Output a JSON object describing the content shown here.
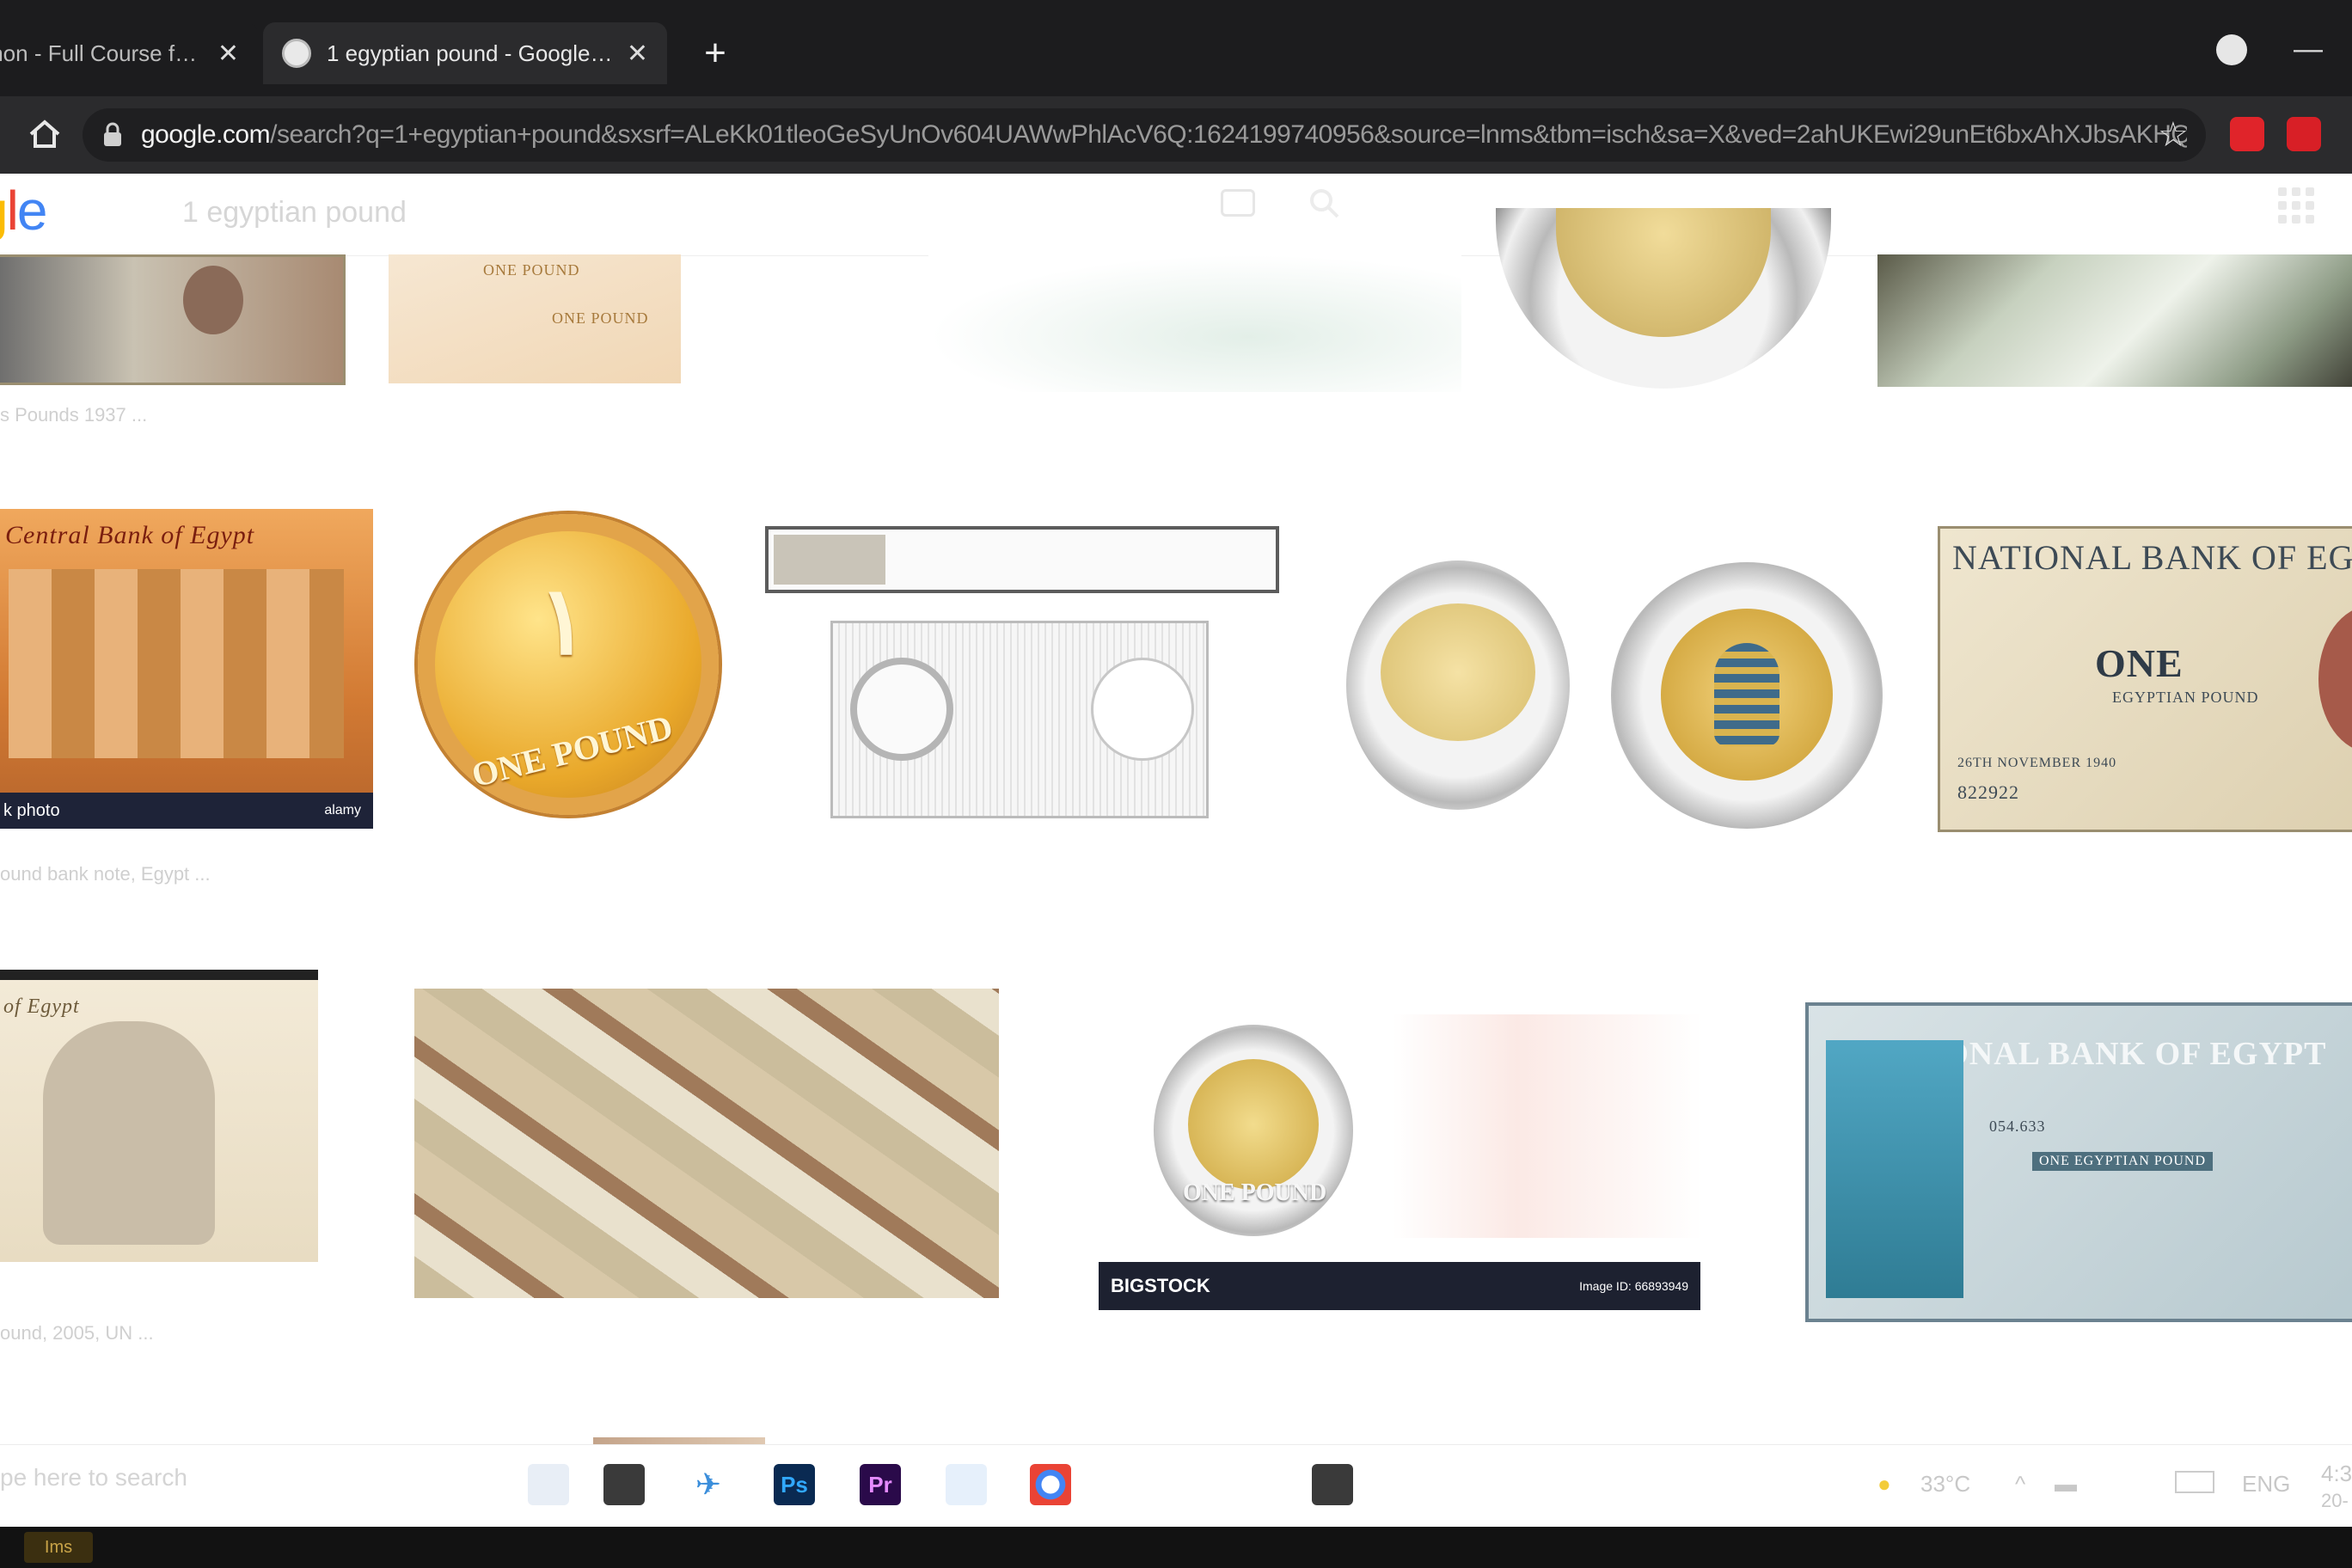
{
  "browser": {
    "tabs": [
      {
        "title": "thon - Full Course for Be",
        "active": false
      },
      {
        "title": "1 egyptian pound - Google Searc",
        "active": true
      }
    ],
    "close_glyph": "✕",
    "new_tab_glyph": "+",
    "minimize_glyph": "—",
    "url_domain": "google.com",
    "url_path": "/search?q=1+egyptian+pound&sxsrf=ALeKk01tleoGeSyUnOv604UAWwPhlAcV6Q:1624199740956&source=lnms&tbm=isch&sa=X&ved=2ahUKEwi29unEt6bxAhXJbsAKHQ...",
    "star_glyph": "☆"
  },
  "google": {
    "logo_letters": [
      "g",
      "l",
      "e"
    ],
    "query": "1 egyptian pound"
  },
  "results": {
    "row1_caption": "s Pounds 1937 ...",
    "note_labels": {
      "one_pound_a": "ONE POUND",
      "one_pound_b": "ONE POUND"
    },
    "central_bank_title": "Central Bank of Egypt",
    "stock_bar_label": "k photo",
    "stock_bar_small": "alamy",
    "gold_coin_numeral": "١",
    "gold_coin_text": "ONE POUND",
    "caption_row2_left": "ound bank note, Egypt ...",
    "national_bank_title": "NATIONAL BANK OF EGYPT",
    "national_bank_one": "ONE",
    "national_bank_sub": "EGYPTIAN POUND",
    "national_bank_date": "26TH NOVEMBER 1940",
    "national_bank_serial": "822922",
    "row3_left_title": "of Egypt",
    "row3_caption": "ound, 2005, UN ...",
    "bigstock_label": "BIGSTOCK",
    "bigstock_small": "Image ID: 66893949",
    "small_coin_text": "ONE POUND",
    "national_bank_blue_title": "NATIONAL BANK OF EGYPT",
    "national_bank_blue_sub": "ONE EGYPTIAN POUND",
    "national_bank_blue_serial": "054.633"
  },
  "taskbar": {
    "search_placeholder": "pe here to search",
    "apps": [
      {
        "name": "Ps",
        "color": "#0a2a52",
        "text_color": "#31a8ff"
      },
      {
        "name": "Pr",
        "color": "#2a0a4a",
        "text_color": "#e58bff"
      }
    ],
    "weather": "33°C",
    "language": "ENG",
    "clock_time": "4:3",
    "clock_date": "20-"
  },
  "bezel_badge": "Ims",
  "colors": {
    "chrome_dark": "#1c1c1e",
    "toolbar": "#2b2b2d",
    "page_bg": "#ffffff",
    "google_yellow": "#fbbc05",
    "google_red": "#ea4335",
    "google_blue": "#4285f4"
  }
}
